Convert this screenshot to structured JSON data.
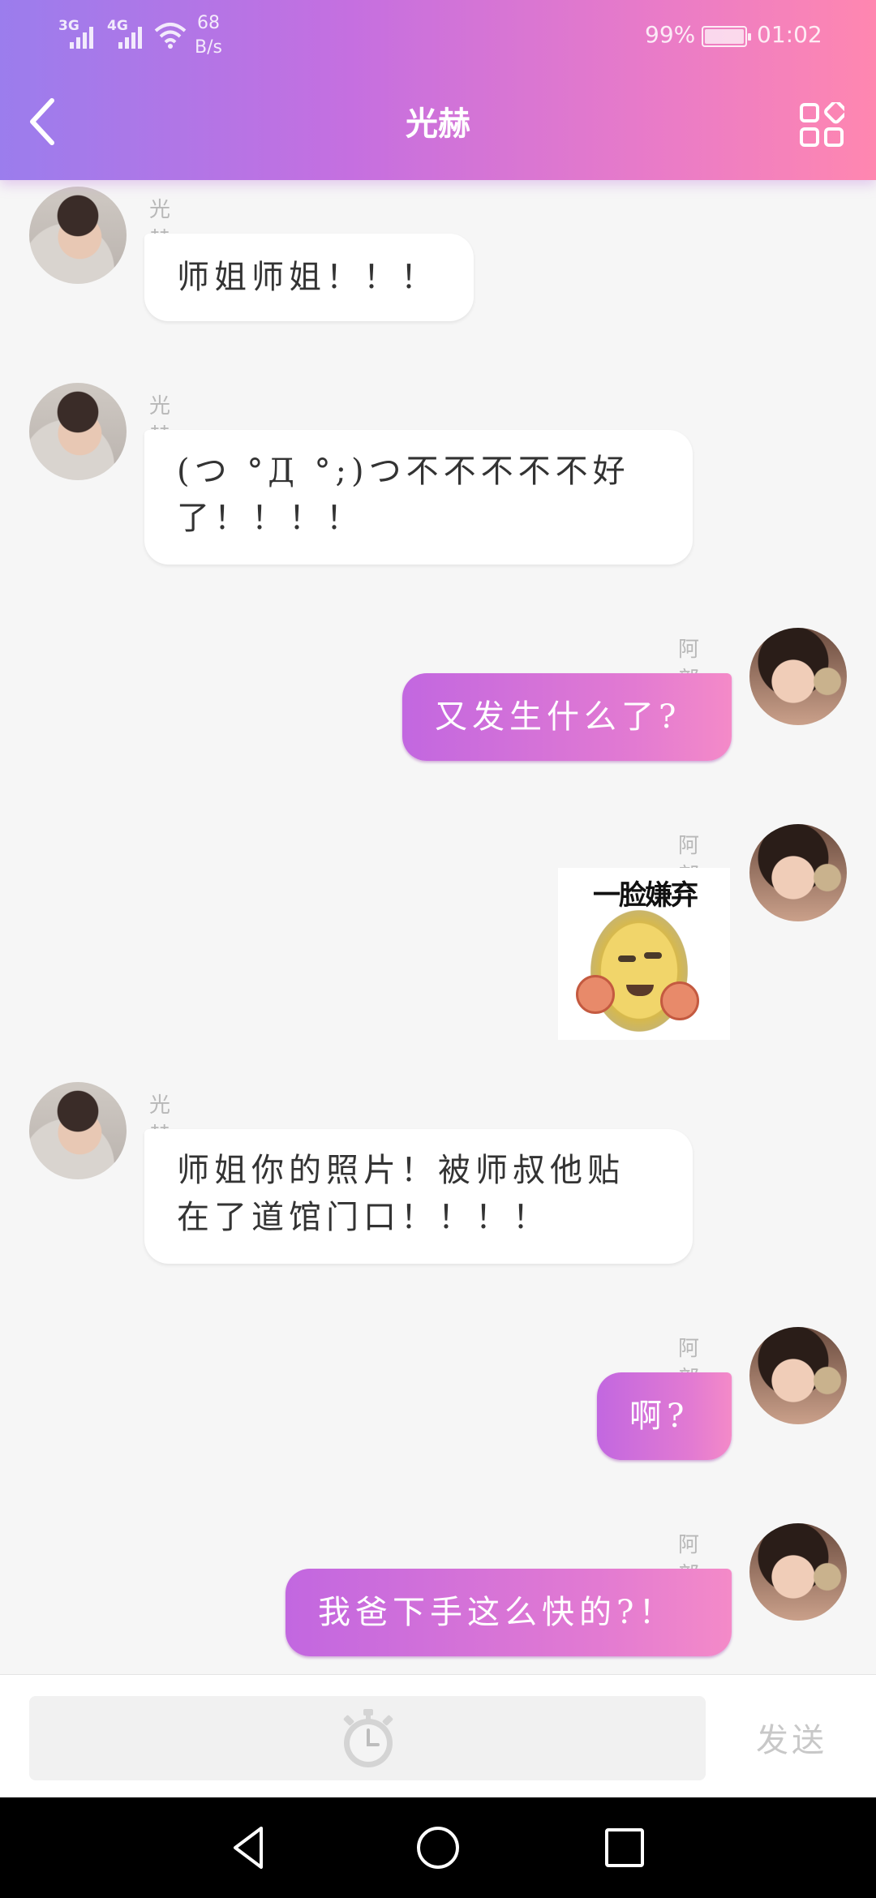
{
  "status_bar": {
    "signal_1": "3G",
    "signal_2": "4G",
    "net_speed_value": "68",
    "net_speed_unit": "B/s",
    "battery": "99%",
    "time": "01:02"
  },
  "header": {
    "title": "光赫"
  },
  "messages": [
    {
      "side": "in",
      "sender": "光赫",
      "text": "师姐师姐！！！"
    },
    {
      "side": "in",
      "sender": "光赫",
      "text_line1": "(つ °Д °;)つ不不不不不好",
      "text_line2": "了！！！！"
    },
    {
      "side": "out",
      "sender": "阿部",
      "text": "又发生什么了?"
    },
    {
      "side": "out",
      "sender": "阿部",
      "sticker_caption": "一脸嫌弃"
    },
    {
      "side": "in",
      "sender": "光赫",
      "text_line1": "师姐你的照片！被师叔他贴",
      "text_line2": "在了道馆门口！！！！"
    },
    {
      "side": "out",
      "sender": "阿部",
      "text": "啊?"
    },
    {
      "side": "out",
      "sender": "阿部",
      "text": "我爸下手这么快的?！"
    }
  ],
  "input": {
    "send_label": "发送",
    "timer_icon": "stopwatch-icon"
  },
  "colors": {
    "header_gradient_start": "#9b7ded",
    "header_gradient_end": "#ff87b0",
    "outgoing_bubble": "#d06fdb",
    "incoming_bubble": "#ffffff"
  }
}
